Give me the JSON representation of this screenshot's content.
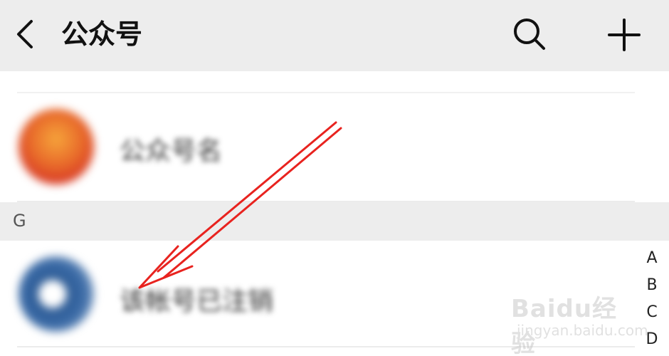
{
  "header": {
    "title": "公众号",
    "back_icon": "chevron-left-icon",
    "search_icon": "search-icon",
    "add_icon": "plus-icon"
  },
  "list": {
    "items": [
      {
        "name": "公众号名",
        "avatar_color": "#e5562b"
      },
      {
        "name": "该帐号已注销",
        "avatar_color": "#2d5b95"
      }
    ],
    "sections": [
      {
        "letter": "G"
      }
    ]
  },
  "index_bar": [
    "A",
    "B",
    "C",
    "D"
  ],
  "annotation": {
    "arrow_color": "#e8231f"
  },
  "watermark": {
    "main": "Baidu经验",
    "sub": "jingyan.baidu.com"
  }
}
